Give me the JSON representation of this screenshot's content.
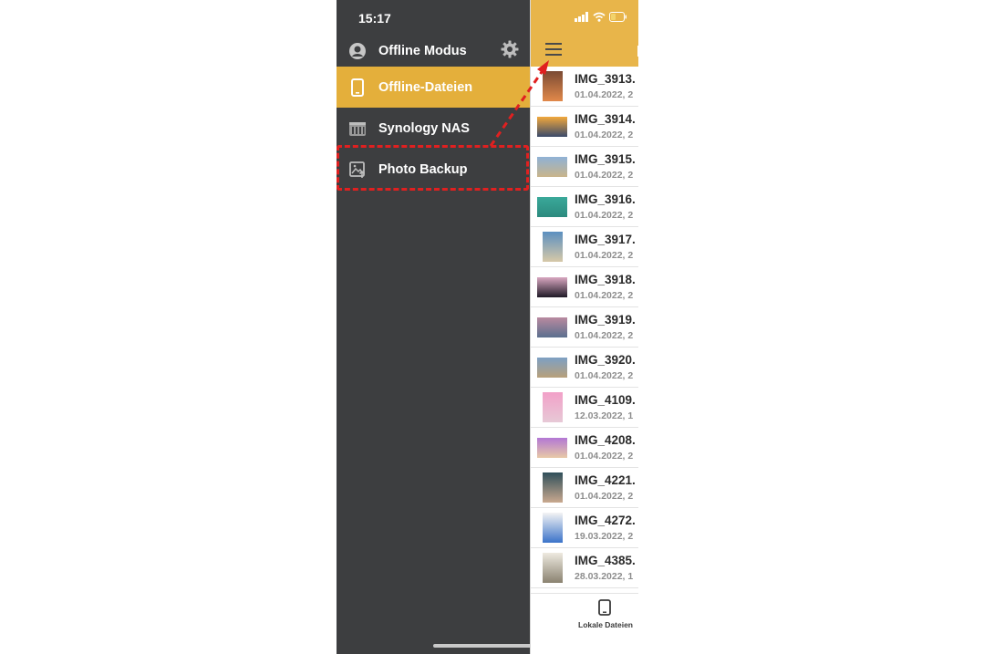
{
  "status_bar": {
    "time": "15:17"
  },
  "drawer": {
    "header_label": "Offline Modus",
    "items": [
      {
        "label": "Offline-Dateien",
        "icon": "phone-icon",
        "active": true
      },
      {
        "label": "Synology NAS",
        "icon": "nas-icon",
        "active": false
      },
      {
        "label": "Photo Backup",
        "icon": "photo-backup-icon",
        "active": false
      }
    ]
  },
  "file_list": [
    {
      "name": "IMG_3913.",
      "date": "01.04.2022, 2",
      "thumb_colors": [
        "#7a4a34",
        "#e2894a"
      ]
    },
    {
      "name": "IMG_3914.",
      "date": "01.04.2022, 2",
      "thumb_colors": [
        "#f2a83c",
        "#3a4a6a"
      ]
    },
    {
      "name": "IMG_3915.",
      "date": "01.04.2022, 2",
      "thumb_colors": [
        "#8fb2d6",
        "#c9b48a"
      ]
    },
    {
      "name": "IMG_3916.",
      "date": "01.04.2022, 2",
      "thumb_colors": [
        "#3aa99a",
        "#2c8a7e"
      ]
    },
    {
      "name": "IMG_3917.",
      "date": "01.04.2022, 2",
      "thumb_colors": [
        "#5b8fc0",
        "#d7c9a8"
      ]
    },
    {
      "name": "IMG_3918.",
      "date": "01.04.2022, 2",
      "thumb_colors": [
        "#d9a7c0",
        "#1f1a26"
      ]
    },
    {
      "name": "IMG_3919.",
      "date": "01.04.2022, 2",
      "thumb_colors": [
        "#b98aa0",
        "#5b6f8e"
      ]
    },
    {
      "name": "IMG_3920.",
      "date": "01.04.2022, 2",
      "thumb_colors": [
        "#7da0c4",
        "#b8a07a"
      ]
    },
    {
      "name": "IMG_4109.",
      "date": "12.03.2022, 1",
      "thumb_colors": [
        "#f2a0c8",
        "#e7c9d6"
      ]
    },
    {
      "name": "IMG_4208.",
      "date": "01.04.2022, 2",
      "thumb_colors": [
        "#b377d4",
        "#e8c9a7"
      ]
    },
    {
      "name": "IMG_4221.",
      "date": "01.04.2022, 2",
      "thumb_colors": [
        "#2f4f5a",
        "#c9a98f"
      ]
    },
    {
      "name": "IMG_4272.",
      "date": "19.03.2022, 2",
      "thumb_colors": [
        "#f4f4f4",
        "#3b73c9"
      ]
    },
    {
      "name": "IMG_4385.",
      "date": "28.03.2022, 1",
      "thumb_colors": [
        "#eeeae0",
        "#8a8270"
      ]
    }
  ],
  "tab_bar": {
    "label": "Lokale Dateien"
  },
  "colors": {
    "accent": "#e4af3b",
    "drawer_bg": "#3d3e40",
    "highlight": "#e02020"
  }
}
